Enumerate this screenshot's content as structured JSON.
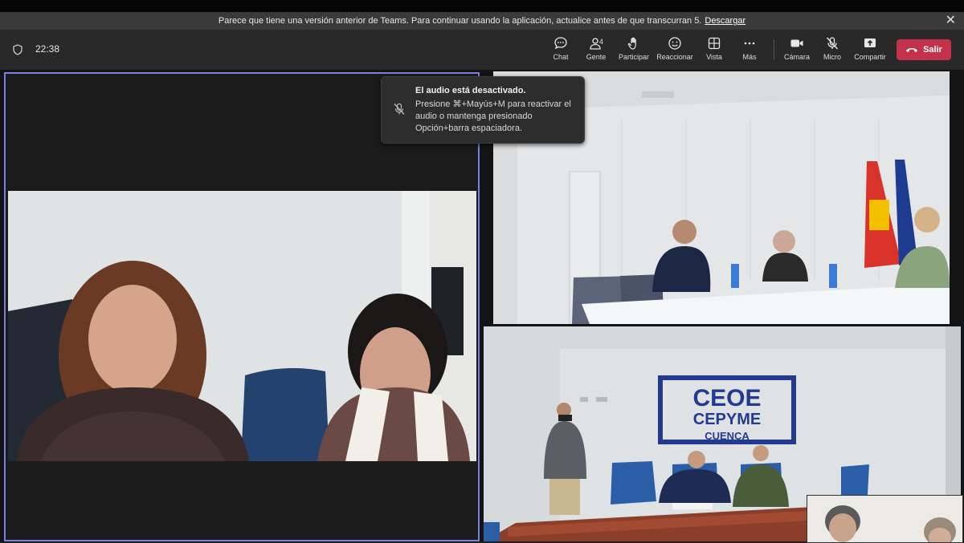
{
  "banner": {
    "message": "Parece que tiene una versión anterior de Teams. Para continuar usando la aplicación, actualice antes de que transcurran 5.",
    "link": "Descargar"
  },
  "meeting": {
    "elapsed": "22:38"
  },
  "toolbar": {
    "chat": "Chat",
    "people": "Gente",
    "people_count": "4",
    "raise_hand": "Participar",
    "react": "Reaccionar",
    "view": "Vista",
    "more": "Más",
    "camera": "Cámara",
    "mic": "Micro",
    "share": "Compartir",
    "leave": "Salir"
  },
  "toast": {
    "title": "El audio está desactivado.",
    "body": "Presione ⌘+Mayús+M para reactivar el audio o mantenga presionado Opción+barra espaciadora."
  },
  "video": {
    "sign_line1": "CEOE",
    "sign_line2": "CEPYME",
    "sign_line3": "CUENCA"
  },
  "colors": {
    "accent": "#7b7fe0",
    "leave": "#c4314b",
    "toolbar": "#292929"
  }
}
